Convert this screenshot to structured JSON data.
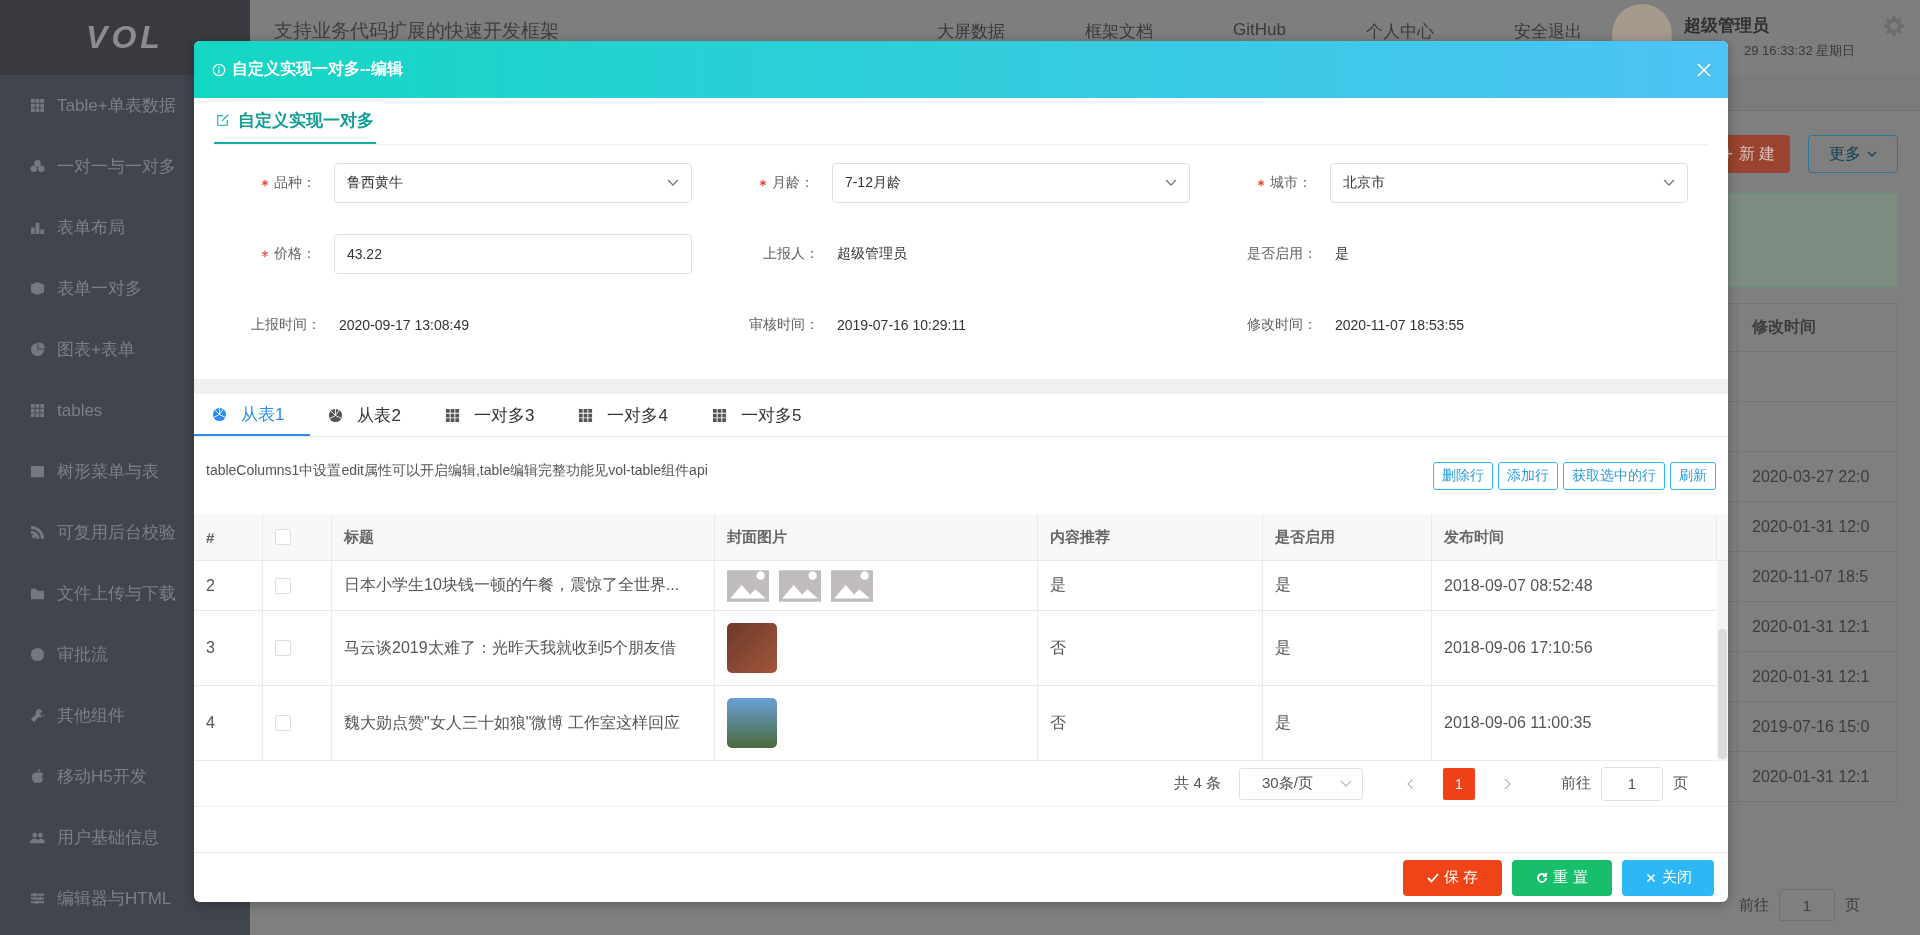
{
  "sidebar": {
    "logo": "VOL",
    "items": [
      {
        "label": "Table+单表数据",
        "kind": "grid"
      },
      {
        "label": "一对一与一对多",
        "kind": "circles"
      },
      {
        "label": "表单布局",
        "kind": "bars"
      },
      {
        "label": "表单一对多",
        "kind": "cube"
      },
      {
        "label": "图表+表单",
        "kind": "pie"
      },
      {
        "label": "tables",
        "kind": "grid"
      },
      {
        "label": "树形菜单与表",
        "kind": "chart"
      },
      {
        "label": "可复用后台校验",
        "kind": "rss"
      },
      {
        "label": "文件上传与下载",
        "kind": "folder"
      },
      {
        "label": "审批流",
        "kind": "aperture"
      },
      {
        "label": "其他组件",
        "kind": "wrench"
      },
      {
        "label": "移动H5开发",
        "kind": "apple"
      },
      {
        "label": "用户基础信息",
        "kind": "users"
      },
      {
        "label": "编辑器与HTML",
        "kind": "sliders"
      }
    ]
  },
  "header": {
    "title": "支持业务代码扩展的快速开发框架",
    "nav": [
      "大屏数据",
      "框架文档",
      "GitHub",
      "个人中心",
      "安全退出"
    ],
    "user_name": "超级管理员",
    "datetime": "29 16:33:32 星期日"
  },
  "page": {
    "toolbar": [
      {
        "label": "新 建",
        "kind": "primary"
      },
      {
        "label": "更多",
        "kind": "dropdown"
      }
    ],
    "table": {
      "column": "修改时间",
      "rows": [
        {},
        {},
        {
          "modified": "2020-03-27 22:0"
        },
        {
          "modified": "2020-01-31 12:0"
        },
        {
          "modified": "2020-11-07 18:5"
        },
        {
          "modified": "2020-01-31 12:1"
        },
        {
          "modified": "2020-01-31 12:1"
        },
        {
          "modified": "2019-07-16 15:0"
        },
        {
          "modified": "2020-01-31 12:1"
        }
      ]
    },
    "pagination": {
      "goto_label": "前往",
      "goto_value": "1",
      "unit": "页"
    }
  },
  "dialog": {
    "title": "自定义实现一对多--编辑",
    "section": "自定义实现一对多",
    "fields": [
      {
        "label": "品种：",
        "required": true,
        "kind": "select",
        "value": "鲁西黄牛"
      },
      {
        "label": "月龄：",
        "required": true,
        "kind": "select",
        "value": "7-12月龄"
      },
      {
        "label": "城市：",
        "required": true,
        "kind": "select",
        "value": "北京市"
      },
      {
        "label": "价格：",
        "required": true,
        "kind": "input",
        "value": "43.22"
      },
      {
        "label": "上报人：",
        "required": false,
        "kind": "text",
        "value": "超级管理员"
      },
      {
        "label": "是否启用：",
        "required": false,
        "kind": "text",
        "value": "是"
      },
      {
        "label": "上报时间：",
        "required": false,
        "kind": "text",
        "value": "2020-09-17 13:08:49"
      },
      {
        "label": "审核时间：",
        "required": false,
        "kind": "text",
        "value": "2019-07-16 10:29:11"
      },
      {
        "label": "修改时间：",
        "required": false,
        "kind": "text",
        "value": "2020-11-07 18:53:55"
      }
    ],
    "tabs": [
      {
        "label": "从表1",
        "kind": "aperture",
        "selected": true
      },
      {
        "label": "从表2",
        "kind": "aperture",
        "selected": false
      },
      {
        "label": "一对多3",
        "kind": "grid",
        "selected": false
      },
      {
        "label": "一对多4",
        "kind": "grid",
        "selected": false
      },
      {
        "label": "一对多5",
        "kind": "grid",
        "selected": false
      }
    ],
    "hint": "tableColumns1中设置edit属性可以开启编辑,table编辑完整功能见vol-table组件api",
    "actions": [
      "删除行",
      "添加行",
      "获取选中的行",
      "刷新"
    ],
    "table": {
      "index_header": "#",
      "header_checkbox": {
        "checked": false
      },
      "columns": [
        "标题",
        "封面图片",
        "内容推荐",
        "是否启用",
        "发布时间"
      ],
      "rows": [
        {
          "index": "2",
          "checked": false,
          "title": "日本小学生10块钱一顿的午餐，震惊了全世界...",
          "covers": [
            {
              "kind": "placeholder"
            },
            {
              "kind": "placeholder"
            },
            {
              "kind": "placeholder"
            }
          ],
          "recommend": "是",
          "enabled": "是",
          "published": "2018-09-07 08:52:48"
        },
        {
          "index": "3",
          "checked": false,
          "title": "马云谈2019太难了：光昨天我就收到5个朋友借",
          "covers": [
            {
              "kind": "photo"
            }
          ],
          "recommend": "否",
          "enabled": "是",
          "published": "2018-09-06 17:10:56"
        },
        {
          "index": "4",
          "checked": false,
          "title": "魏大勋点赞\"女人三十如狼\"微博 工作室这样回应",
          "covers": [
            {
              "kind": "photo"
            }
          ],
          "recommend": "否",
          "enabled": "是",
          "published": "2018-09-06 11:00:35"
        }
      ]
    },
    "pagination": {
      "total": "共 4 条",
      "page_size": "30条/页",
      "pages": [
        {
          "label": "1",
          "selected": true
        }
      ],
      "goto_label": "前往",
      "goto_value": "1",
      "unit": "页"
    },
    "buttons": [
      {
        "label": "保 存",
        "kind": "save"
      },
      {
        "label": "重 置",
        "kind": "reset"
      },
      {
        "label": "关闭",
        "kind": "close"
      }
    ]
  }
}
